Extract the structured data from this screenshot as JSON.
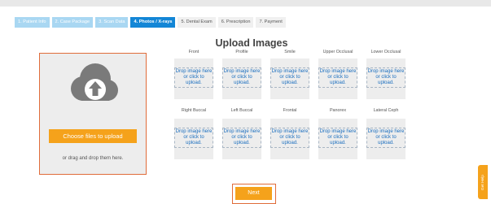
{
  "steps": [
    {
      "label": "1. Patient Info",
      "state": "done"
    },
    {
      "label": "2. Case Package",
      "state": "done"
    },
    {
      "label": "3. Scan Data",
      "state": "done"
    },
    {
      "label": "4. Photos / X-rays",
      "state": "active"
    },
    {
      "label": "5. Dental Exam",
      "state": "todo"
    },
    {
      "label": "6. Prescription",
      "state": "todo"
    },
    {
      "label": "7. Payment",
      "state": "todo"
    }
  ],
  "page": {
    "title": "Upload Images"
  },
  "upload": {
    "icon": "cloud-upload-icon",
    "button_label": "Choose files to upload",
    "drag_text": "or drag and drop them here."
  },
  "image_slots_row1": [
    {
      "label": "Front",
      "drop_text": "Drop image here or click to upload."
    },
    {
      "label": "Profile",
      "drop_text": "Drop image here or click to upload."
    },
    {
      "label": "Smile",
      "drop_text": "Drop image here or click to upload."
    },
    {
      "label": "Upper Occlusal",
      "drop_text": "Drop image here or click to upload."
    },
    {
      "label": "Lower Occlusal",
      "drop_text": "Drop image here or click to upload."
    }
  ],
  "image_slots_row2": [
    {
      "label": "Right Buccal",
      "drop_text": "Drop image here or click to upload."
    },
    {
      "label": "Left Buccal",
      "drop_text": "Drop image here or click to upload."
    },
    {
      "label": "Frontal",
      "drop_text": "Drop image here or click to upload."
    },
    {
      "label": "Panorex",
      "drop_text": "Drop image here or click to upload."
    },
    {
      "label": "Lateral Ceph",
      "drop_text": "Drop image here or click to upload."
    }
  ],
  "footer": {
    "next_label": "Next"
  },
  "help": {
    "label": "Get Help"
  },
  "colors": {
    "accent": "#f5a21b",
    "active_step": "#1386d6",
    "done_step": "#a9d7f2",
    "highlight_border": "#e06c3a",
    "link": "#1a6ebf"
  }
}
